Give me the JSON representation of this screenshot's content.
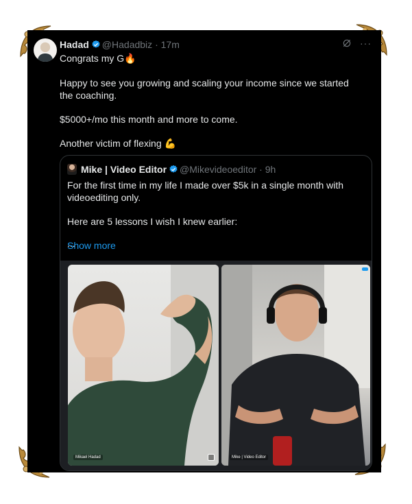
{
  "tweet": {
    "name": "Hadad",
    "handle": "@Hadadbiz",
    "sep": "·",
    "time": "17m",
    "more_label": "···",
    "paragraphs": [
      "Congrats my G",
      "Happy to see you growing and scaling your income since we started the coaching.",
      "$5000+/mo this month and more to come.",
      "Another victim of flexing"
    ],
    "emoji_fire": "🔥",
    "emoji_flex": "💪"
  },
  "quote": {
    "name": "Mike | Video Editor",
    "handle": "@Mikevideoeditor",
    "sep": "·",
    "time": "9h",
    "paragraphs": [
      "For the first time in my life I made over $5k in a single month with videoediting only.",
      "Here are 5 lessons I wish I knew earlier:",
      "..."
    ],
    "show_more": "Show more",
    "media": {
      "left_label": "Mikael Hadad",
      "right_label": "Mike | Video Editor"
    }
  },
  "icons": {
    "verified": "verified-badge-icon",
    "grok": "grok-icon",
    "more": "more-icon"
  },
  "colors": {
    "background": "#000000",
    "text": "#e7e9ea",
    "muted": "#71767b",
    "link": "#1d9bf0",
    "border": "#2f3336",
    "frame_gold": "#b8893a"
  }
}
